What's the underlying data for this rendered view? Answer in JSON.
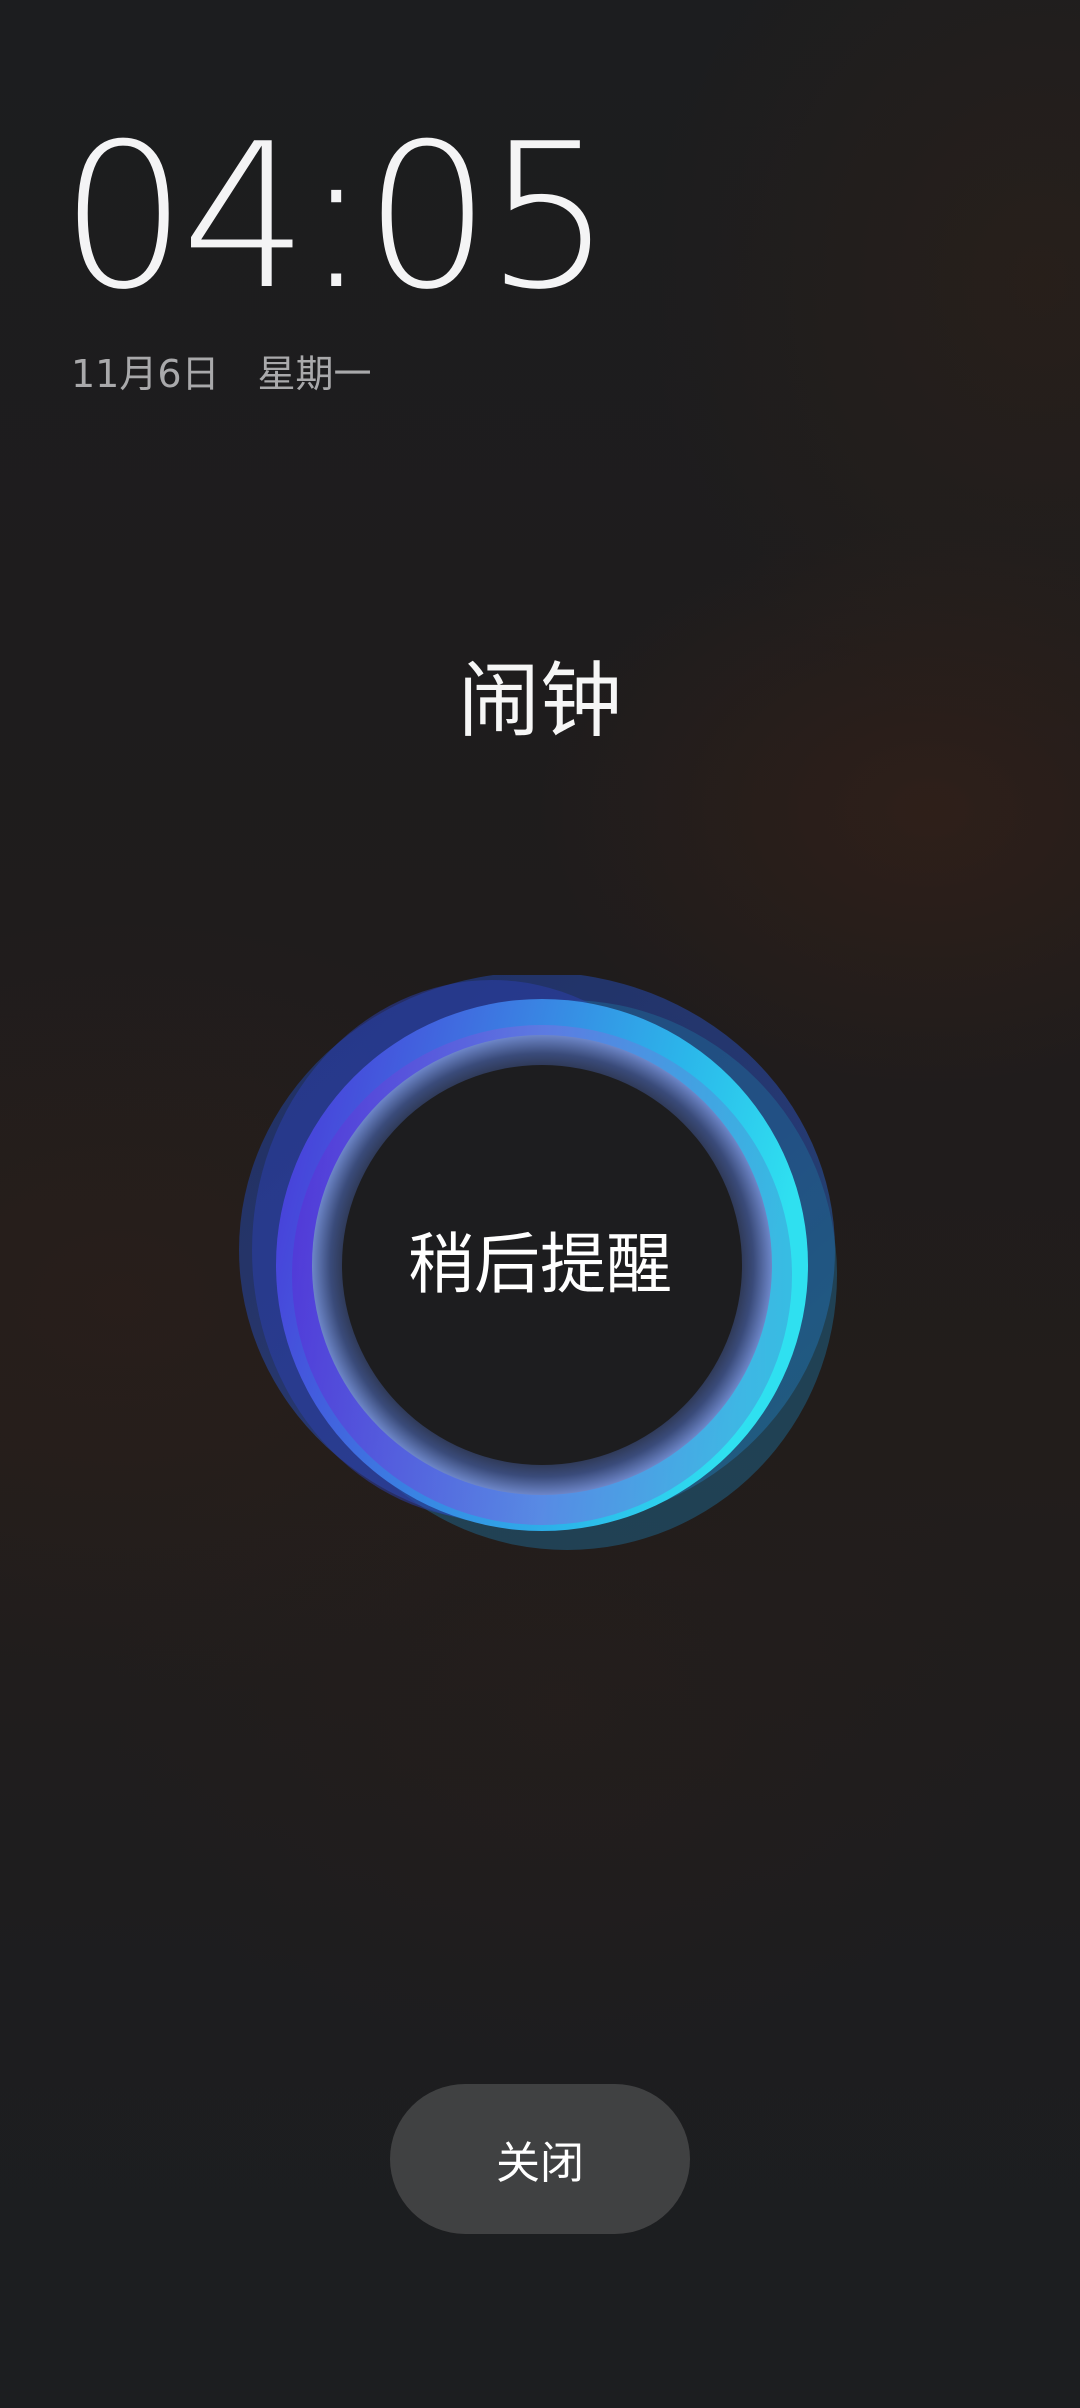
{
  "lockscreen": {
    "time": "04:05",
    "date": "11月6日",
    "weekday": "星期一"
  },
  "alarm": {
    "title": "闹钟",
    "snooze_label": "稍后提醒",
    "dismiss_label": "关闭"
  },
  "colors": {
    "ring_cyan": "#2fd4ee",
    "ring_violet": "#5a3de0",
    "ring_blue": "#2f56c8",
    "button_bg": "#404142"
  }
}
